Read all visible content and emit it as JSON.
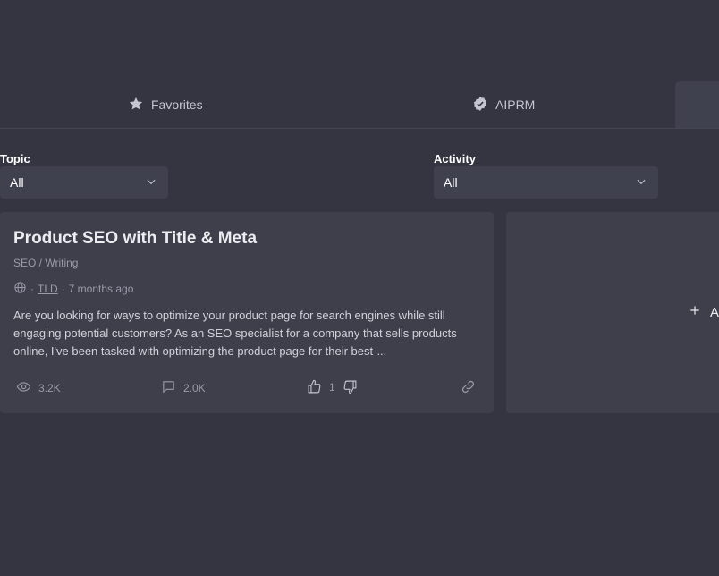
{
  "tabs": [
    {
      "label": "Favorites",
      "icon": "star-icon"
    },
    {
      "label": "AIPRM",
      "icon": "verified-badge-icon"
    }
  ],
  "filters": {
    "topic": {
      "label": "Topic",
      "value": "All"
    },
    "activity": {
      "label": "Activity",
      "value": "All"
    }
  },
  "card": {
    "title": "Product SEO with Title & Meta",
    "topic": "SEO / Writing",
    "separator1": "·",
    "author": "TLD",
    "separator2": "·",
    "time": "7 months ago",
    "description": "Are you looking for ways to optimize your product page for search engines while still engaging potential customers? As an SEO specialist for a company that sells products online, I've been tasked with optimizing the product page for their best-...",
    "views": "3.2K",
    "comments": "2.0K",
    "likes": "1"
  },
  "card2": {
    "add_label": "A"
  },
  "colors": {
    "background": "#343541",
    "surface": "#40414f",
    "card": "#3e3f4b",
    "muted": "#9a9aa8"
  }
}
